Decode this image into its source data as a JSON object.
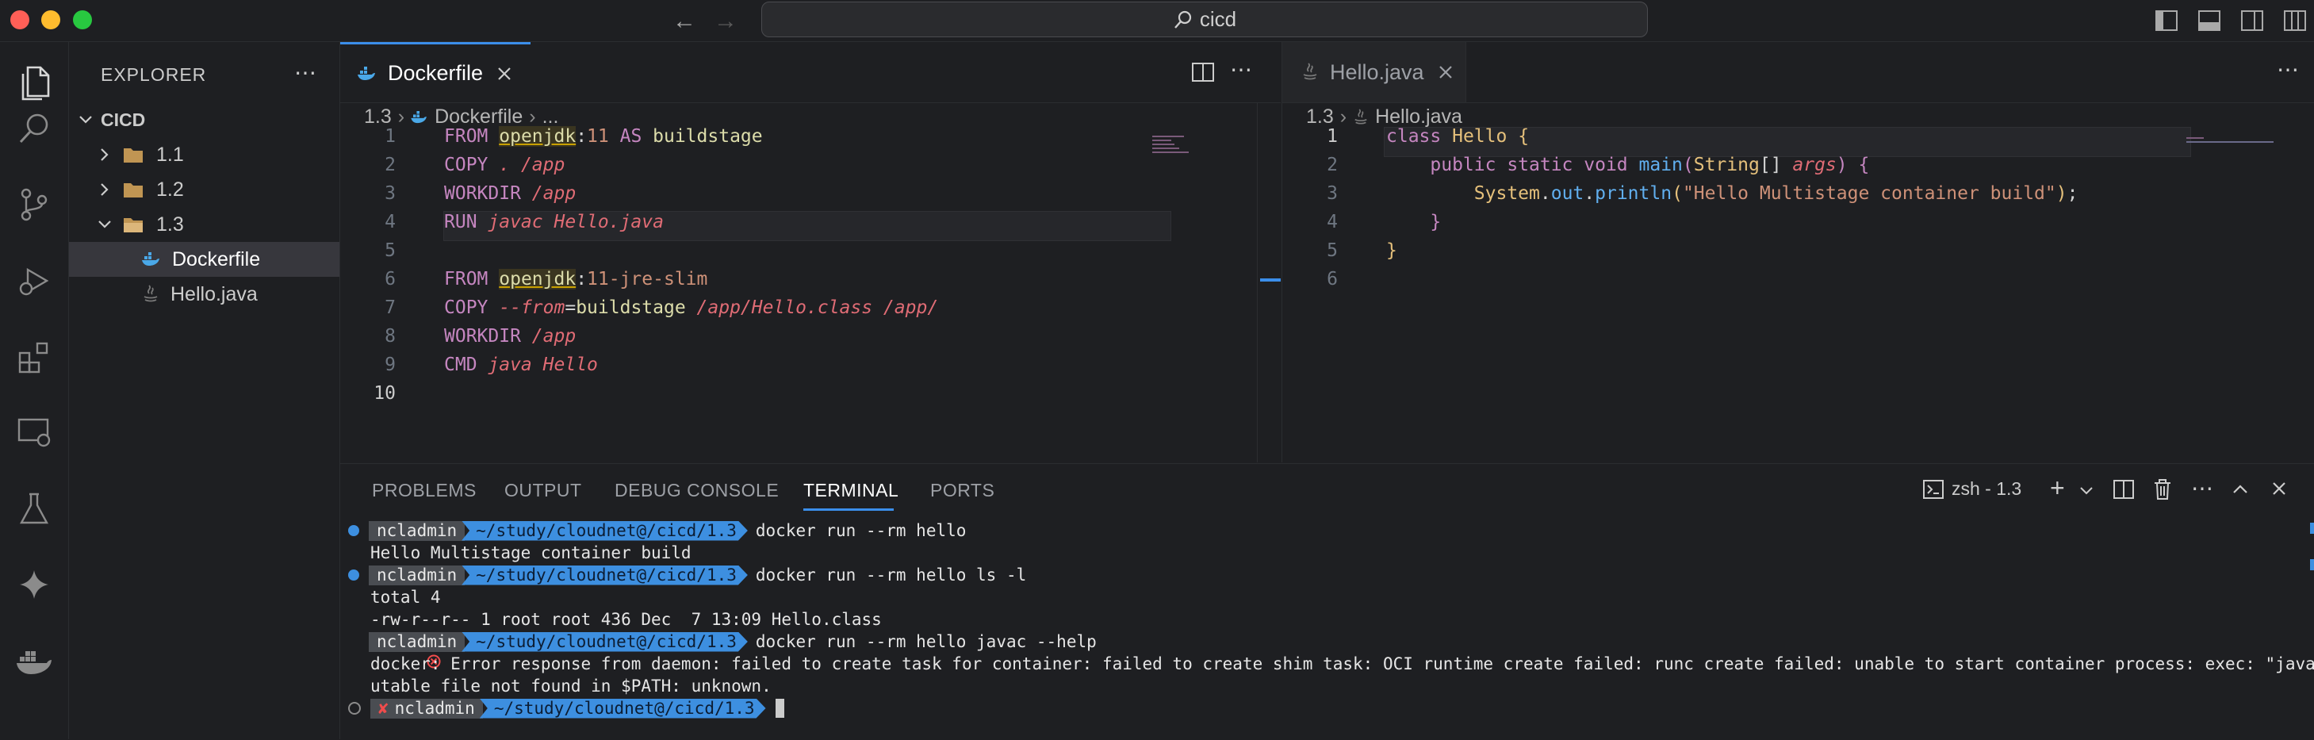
{
  "titlebar": {
    "search_text": "cicd"
  },
  "sidebar": {
    "title": "EXPLORER",
    "root": "CICD",
    "items": [
      {
        "label": "1.1",
        "type": "folder",
        "expanded": false
      },
      {
        "label": "1.2",
        "type": "folder",
        "expanded": false
      },
      {
        "label": "1.3",
        "type": "folder",
        "expanded": true
      },
      {
        "label": "Dockerfile",
        "type": "file",
        "selected": true
      },
      {
        "label": "Hello.java",
        "type": "file",
        "selected": false
      }
    ]
  },
  "left_editor": {
    "tab_label": "Dockerfile",
    "breadcrumb": {
      "folder": "1.3",
      "file": "Dockerfile",
      "tail": "..."
    },
    "line_numbers": [
      "1",
      "2",
      "3",
      "4",
      "5",
      "6",
      "7",
      "8",
      "9",
      "10"
    ],
    "current_line": "10"
  },
  "right_editor": {
    "tab_label": "Hello.java",
    "breadcrumb": {
      "folder": "1.3",
      "file": "Hello.java"
    },
    "line_numbers": [
      "1",
      "2",
      "3",
      "4",
      "5",
      "6"
    ],
    "current_line": "1"
  },
  "panel": {
    "tabs": [
      "PROBLEMS",
      "OUTPUT",
      "DEBUG CONSOLE",
      "TERMINAL",
      "PORTS"
    ],
    "active_tab": "TERMINAL",
    "terminal_name": "zsh - 1.3"
  },
  "terminal": {
    "user": "ncladmin",
    "path": "~/study/cloudnet@/cicd/1.3",
    "cmd1": "docker run --rm hello",
    "out1": "Hello Multistage container build",
    "cmd2": "docker run --rm hello ls -l",
    "out2a": "total 4",
    "out2b": "-rw-r--r-- 1 root root 436 Dec  7 13:09 Hello.class",
    "cmd3": "docker run --rm hello javac --help",
    "out3a": "docker: Error response from daemon: failed to create task for container: failed to create shim task: OCI runtime create failed: runc create failed: unable to start container process: exec: \"javac\": exec",
    "out3b": "utable file not found in $PATH: unknown.",
    "fail_mark": "✘",
    "colors": {
      "path_bg": "#3d8fe0",
      "user_bg": "#4a4d52",
      "error_marker": "#f14c4c",
      "ok_marker": "#3d8fe0"
    }
  },
  "colors": {
    "accent": "#3b8eea",
    "background": "#1e1f22"
  }
}
